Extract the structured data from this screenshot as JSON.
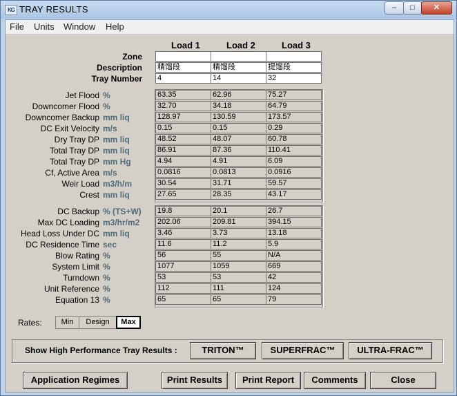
{
  "window": {
    "title": "TRAY RESULTS",
    "icon": "KG",
    "min": "–",
    "max": "□",
    "close": "✕"
  },
  "menu": [
    "File",
    "Units",
    "Window",
    "Help"
  ],
  "loads": [
    "Load 1",
    "Load 2",
    "Load 3"
  ],
  "header_rows": [
    {
      "label": "Zone",
      "values": [
        "",
        "",
        ""
      ]
    },
    {
      "label": "Description",
      "values": [
        "精馏段",
        "精馏段",
        "提馏段"
      ]
    },
    {
      "label": "Tray Number",
      "values": [
        "4",
        "14",
        "32"
      ]
    }
  ],
  "group1": [
    {
      "label": "Jet Flood",
      "unit": "%",
      "values": [
        "63.35",
        "62.96",
        "75.27"
      ]
    },
    {
      "label": "Downcomer Flood",
      "unit": "%",
      "values": [
        "32.70",
        "34.18",
        "64.79"
      ]
    },
    {
      "label": "Downcomer Backup",
      "unit": "mm liq",
      "values": [
        "128.97",
        "130.59",
        "173.57"
      ]
    },
    {
      "label": "DC Exit Velocity",
      "unit": "m/s",
      "values": [
        "0.15",
        "0.15",
        "0.29"
      ]
    },
    {
      "label": "Dry Tray DP",
      "unit": "mm liq",
      "values": [
        "48.52",
        "48.07",
        "60.78"
      ]
    },
    {
      "label": "Total Tray DP",
      "unit": "mm liq",
      "values": [
        "86.91",
        "87.36",
        "110.41"
      ]
    },
    {
      "label": "Total Tray DP",
      "unit": "mm Hg",
      "values": [
        "4.94",
        "4.91",
        "6.09"
      ]
    },
    {
      "label": "Cf, Active Area",
      "unit": "m/s",
      "values": [
        "0.0816",
        "0.0813",
        "0.0916"
      ]
    },
    {
      "label": "Weir Load",
      "unit": "m3/h/m",
      "values": [
        "30.54",
        "31.71",
        "59.57"
      ]
    },
    {
      "label": "Crest",
      "unit": "mm liq",
      "values": [
        "27.65",
        "28.35",
        "43.17"
      ]
    }
  ],
  "group2": [
    {
      "label": "DC Backup",
      "unit": "% (TS+W)",
      "values": [
        "19.8",
        "20.1",
        "26.7"
      ]
    },
    {
      "label": "Max DC Loading",
      "unit": "m3/hr/m2",
      "values": [
        "202.06",
        "209.81",
        "394.15"
      ]
    },
    {
      "label": "Head Loss Under DC",
      "unit": "mm liq",
      "values": [
        "3.46",
        "3.73",
        "13.18"
      ]
    },
    {
      "label": "DC Residence Time",
      "unit": "sec",
      "values": [
        "11.6",
        "11.2",
        "5.9"
      ]
    },
    {
      "label": "Blow Rating",
      "unit": "%",
      "values": [
        "56",
        "55",
        "N/A"
      ]
    },
    {
      "label": "System Limit",
      "unit": "%",
      "values": [
        "1077",
        "1059",
        "669"
      ]
    },
    {
      "label": "Turndown",
      "unit": "%",
      "values": [
        "53",
        "53",
        "42"
      ]
    },
    {
      "label": "Unit Reference",
      "unit": "%",
      "values": [
        "112",
        "111",
        "124"
      ]
    },
    {
      "label": "Equation 13",
      "unit": "%",
      "values": [
        "65",
        "65",
        "79"
      ]
    }
  ],
  "rates": {
    "label": "Rates:",
    "options": [
      "Min",
      "Design",
      "Max"
    ],
    "selected": "Max"
  },
  "high_perf": {
    "label": "Show High Performance Tray Results :",
    "buttons": [
      "TRITON™",
      "SUPERFRAC™",
      "ULTRA-FRAC™"
    ]
  },
  "footer": {
    "application": "Application Regimes",
    "print_results": "Print Results",
    "print_report": "Print Report",
    "comments": "Comments",
    "close": "Close"
  }
}
